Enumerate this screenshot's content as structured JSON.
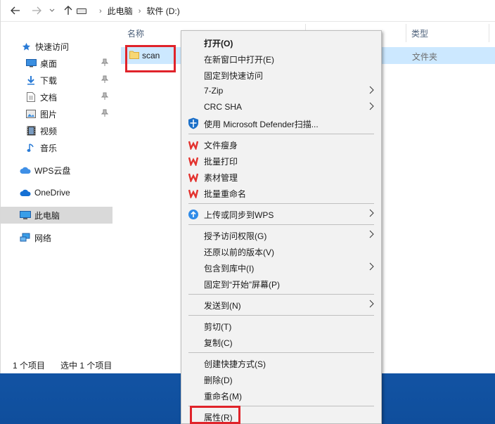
{
  "address": {
    "crumbs": [
      "此电脑",
      "软件 (D:)"
    ]
  },
  "sidebar": {
    "items": [
      {
        "label": "快速访问",
        "icon": "star-icon"
      },
      {
        "label": "桌面",
        "icon": "desktop-icon",
        "pinned": true
      },
      {
        "label": "下载",
        "icon": "download-icon",
        "pinned": true
      },
      {
        "label": "文档",
        "icon": "document-icon",
        "pinned": true
      },
      {
        "label": "图片",
        "icon": "picture-icon",
        "pinned": true
      },
      {
        "label": "视频",
        "icon": "video-icon"
      },
      {
        "label": "音乐",
        "icon": "music-icon"
      },
      {
        "label": "WPS云盘",
        "icon": "wps-cloud-icon"
      },
      {
        "label": "OneDrive",
        "icon": "onedrive-icon"
      },
      {
        "label": "此电脑",
        "icon": "computer-icon",
        "selected": true
      },
      {
        "label": "网络",
        "icon": "network-icon"
      }
    ]
  },
  "columns": {
    "name": "名称",
    "type": "类型"
  },
  "file": {
    "name": "scan",
    "type": "文件夹"
  },
  "status": {
    "count": "1 个项目",
    "selected": "选中 1 个项目"
  },
  "context_menu": {
    "items": [
      {
        "label": "打开(O)",
        "bold": true
      },
      {
        "label": "在新窗口中打开(E)"
      },
      {
        "label": "固定到快速访问"
      },
      {
        "label": "7-Zip",
        "submenu": true
      },
      {
        "label": "CRC SHA",
        "submenu": true
      },
      {
        "label": "使用 Microsoft Defender扫描...",
        "icon": "defender-shield-icon"
      },
      {
        "label": "文件瘦身",
        "icon": "wps-icon"
      },
      {
        "label": "批量打印",
        "icon": "wps-icon"
      },
      {
        "label": "素材管理",
        "icon": "wps-icon"
      },
      {
        "label": "批量重命名",
        "icon": "wps-icon"
      },
      {
        "label": "上传或同步到WPS",
        "icon": "cloud-upload-icon",
        "submenu": true
      },
      {
        "label": "授予访问权限(G)",
        "submenu": true
      },
      {
        "label": "还原以前的版本(V)"
      },
      {
        "label": "包含到库中(I)",
        "submenu": true
      },
      {
        "label": "固定到“开始”屏幕(P)"
      },
      {
        "label": "发送到(N)",
        "submenu": true
      },
      {
        "label": "剪切(T)"
      },
      {
        "label": "复制(C)"
      },
      {
        "label": "创建快捷方式(S)"
      },
      {
        "label": "删除(D)"
      },
      {
        "label": "重命名(M)"
      },
      {
        "label": "属性(R)"
      }
    ]
  },
  "colors": {
    "selection": "#cce8ff",
    "highlight_box": "#e0232a",
    "wps_red": "#e3312d",
    "accent_blue": "#1b62b8"
  }
}
